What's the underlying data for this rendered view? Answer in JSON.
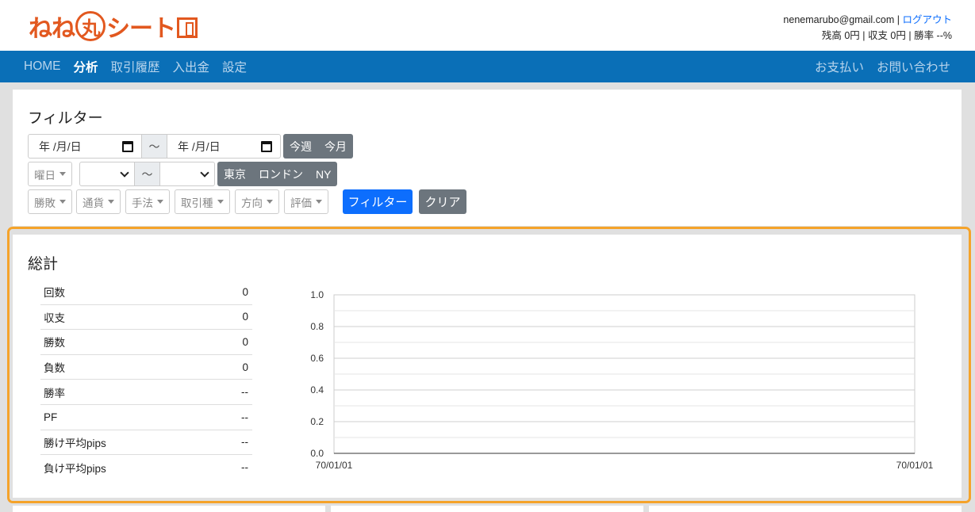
{
  "header": {
    "logo_text": [
      "ねね",
      "丸",
      "シート"
    ],
    "email": "nenemarubo@gmail.com",
    "separator": "|",
    "logout": "ログアウト",
    "status_line": "残高 0円 | 収支 0円 | 勝率 --%"
  },
  "nav": {
    "left": [
      "HOME",
      "分析",
      "取引履歴",
      "入出金",
      "設定"
    ],
    "active": "分析",
    "right": [
      "お支払い",
      "お問い合わせ"
    ],
    "bg_color": "#0a6fb7"
  },
  "filter": {
    "title": "フィルター",
    "date_from_placeholder": "年 /月/日",
    "date_to_placeholder": "年 /月/日",
    "tilde": "～",
    "period_buttons": [
      "今週",
      "今月"
    ],
    "weekday_label": "曜日",
    "session_buttons": [
      "東京",
      "ロンドン",
      "NY"
    ],
    "dropdowns": [
      "勝敗",
      "通貨",
      "手法",
      "取引種",
      "方向",
      "評価"
    ],
    "apply_label": "フィルター",
    "clear_label": "クリア"
  },
  "summary": {
    "title": "総計",
    "stats": [
      {
        "label": "回数",
        "value": "0"
      },
      {
        "label": "収支",
        "value": "0"
      },
      {
        "label": "勝数",
        "value": "0"
      },
      {
        "label": "負数",
        "value": "0"
      },
      {
        "label": "勝率",
        "value": "--"
      },
      {
        "label": "PF",
        "value": "--"
      },
      {
        "label": "勝け平均pips",
        "value": "--"
      },
      {
        "label": "負け平均pips",
        "value": "--"
      }
    ],
    "highlight_color": "#f5a32a"
  },
  "chart_data": {
    "type": "line",
    "x": [
      "70/01/01",
      "70/01/01"
    ],
    "series": [
      {
        "values": [
          0,
          0
        ]
      }
    ],
    "ylim": [
      0,
      1.0
    ],
    "yticks": [
      "0.0",
      "0.2",
      "0.4",
      "0.6",
      "0.8",
      "1.0"
    ],
    "xticks": [
      "70/01/01",
      "70/01/01"
    ],
    "grid": true,
    "title": "",
    "xlabel": "",
    "ylabel": ""
  }
}
